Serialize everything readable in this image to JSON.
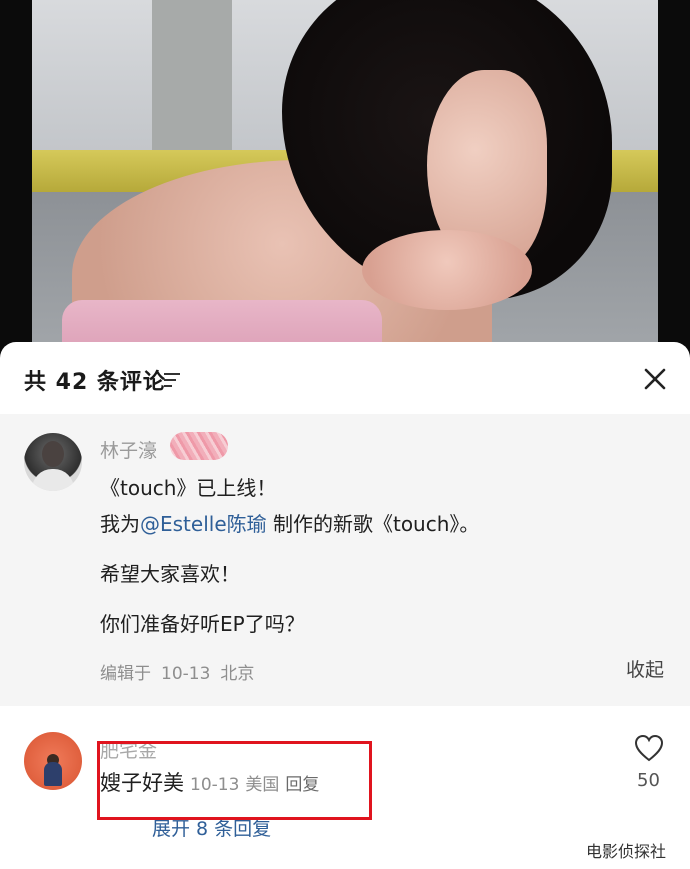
{
  "header": {
    "title": "共 42 条评论"
  },
  "pinned_comment": {
    "author": "林子濠",
    "lines": {
      "l1": "《touch》已上线！",
      "l2_pre": "我为",
      "l2_mention": "@Estelle陈瑜",
      "l2_post": " 制作的新歌《touch》。",
      "l3": "希望大家喜欢！",
      "l4": "你们准备好听EP了吗？"
    },
    "meta": {
      "edited": "编辑于",
      "date": "10-13",
      "location": "北京"
    },
    "collapse_label": "收起"
  },
  "reply_comment": {
    "author": "肥宅金",
    "text": "嫂子好美",
    "date": "10-13",
    "location": "美国",
    "reply_label": "回复",
    "expand_label": "展开 8 条回复",
    "likes": "50"
  },
  "watermark": "电影侦探社",
  "colors": {
    "mention": "#2f5f98",
    "highlight_box": "#e0141e",
    "pinned_bg": "#f5f5f5"
  },
  "icons": [
    "sort-icon",
    "close-icon",
    "heart-icon"
  ]
}
